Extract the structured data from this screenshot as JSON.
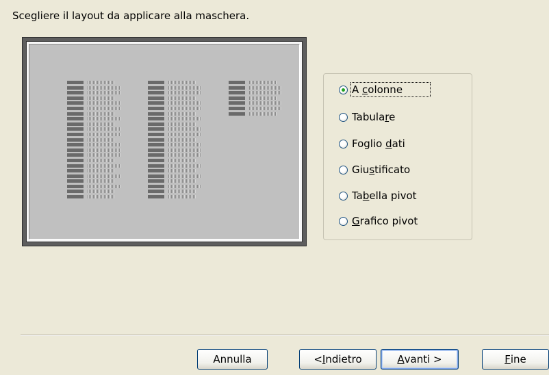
{
  "instruction": "Scegliere il layout da applicare alla maschera.",
  "layout_options": [
    {
      "pre": "A ",
      "key": "c",
      "post": "olonne",
      "checked": true
    },
    {
      "pre": "Tabula",
      "key": "r",
      "post": "e",
      "checked": false
    },
    {
      "pre": "Foglio ",
      "key": "d",
      "post": "ati",
      "checked": false
    },
    {
      "pre": "Giu",
      "key": "s",
      "post": "tificato",
      "checked": false
    },
    {
      "pre": "Ta",
      "key": "b",
      "post": "ella pivot",
      "checked": false
    },
    {
      "pre": "",
      "key": "G",
      "post": "rafico pivot",
      "checked": false
    }
  ],
  "buttons": {
    "cancel": "Annulla",
    "back": {
      "pre": "< ",
      "key": "I",
      "post": "ndietro"
    },
    "next": {
      "pre": "",
      "key": "A",
      "post": "vanti >"
    },
    "finish": {
      "pre": "",
      "key": "F",
      "post": "ine"
    }
  },
  "colors": {
    "window_bg": "#ece9d8",
    "radio_dot": "#21a121",
    "button_border": "#003c74"
  }
}
